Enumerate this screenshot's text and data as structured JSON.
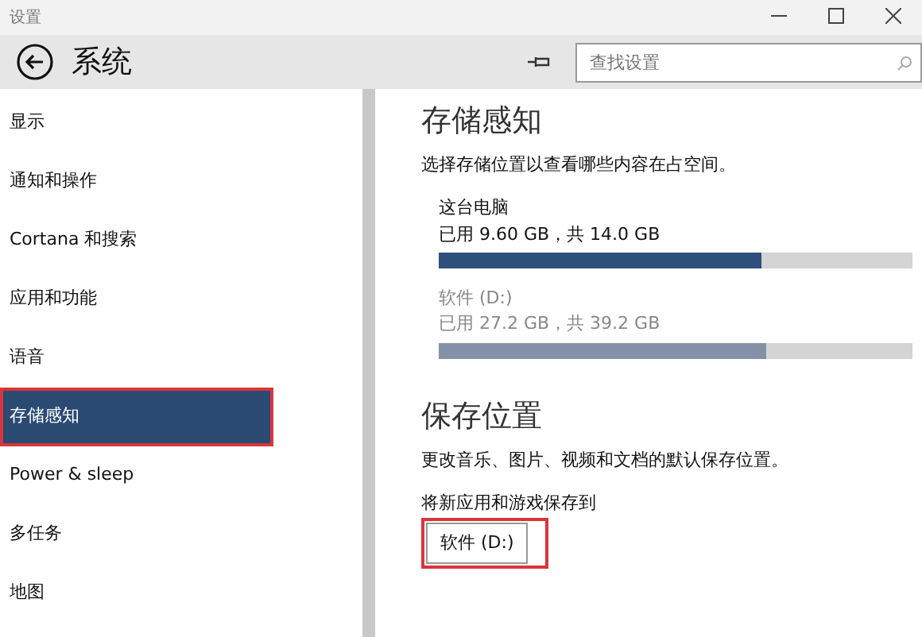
{
  "window": {
    "title": "设置"
  },
  "header": {
    "title": "系统",
    "search": {
      "placeholder": "查找设置"
    }
  },
  "sidebar": {
    "items": [
      {
        "label": "显示",
        "selected": false,
        "highlighted": false
      },
      {
        "label": "通知和操作",
        "selected": false,
        "highlighted": false
      },
      {
        "label": "Cortana 和搜索",
        "selected": false,
        "highlighted": false
      },
      {
        "label": "应用和功能",
        "selected": false,
        "highlighted": false
      },
      {
        "label": "语音",
        "selected": false,
        "highlighted": false
      },
      {
        "label": "存储感知",
        "selected": true,
        "highlighted": true
      },
      {
        "label": "Power & sleep",
        "selected": false,
        "highlighted": false
      },
      {
        "label": "多任务",
        "selected": false,
        "highlighted": false
      },
      {
        "label": "地图",
        "selected": false,
        "highlighted": false
      }
    ]
  },
  "storage": {
    "title": "存储感知",
    "description": "选择存储位置以查看哪些内容在占空间。",
    "drives": [
      {
        "name": "这台电脑",
        "usage": "已用 9.60 GB，共 14.0 GB",
        "level": 0.68,
        "color": "#2d4f7c",
        "dimmed": false
      },
      {
        "name": "软件 (D:)",
        "usage": "已用 27.2 GB，共 39.2 GB",
        "level": 0.69,
        "color": "#8391a8",
        "dimmed": true
      }
    ]
  },
  "save_locations": {
    "title": "保存位置",
    "description": "更改音乐、图片、视频和文档的默认保存位置。",
    "settings": [
      {
        "label": "将新应用和游戏保存到",
        "value": "软件 (D:)",
        "highlighted": true
      }
    ]
  }
}
